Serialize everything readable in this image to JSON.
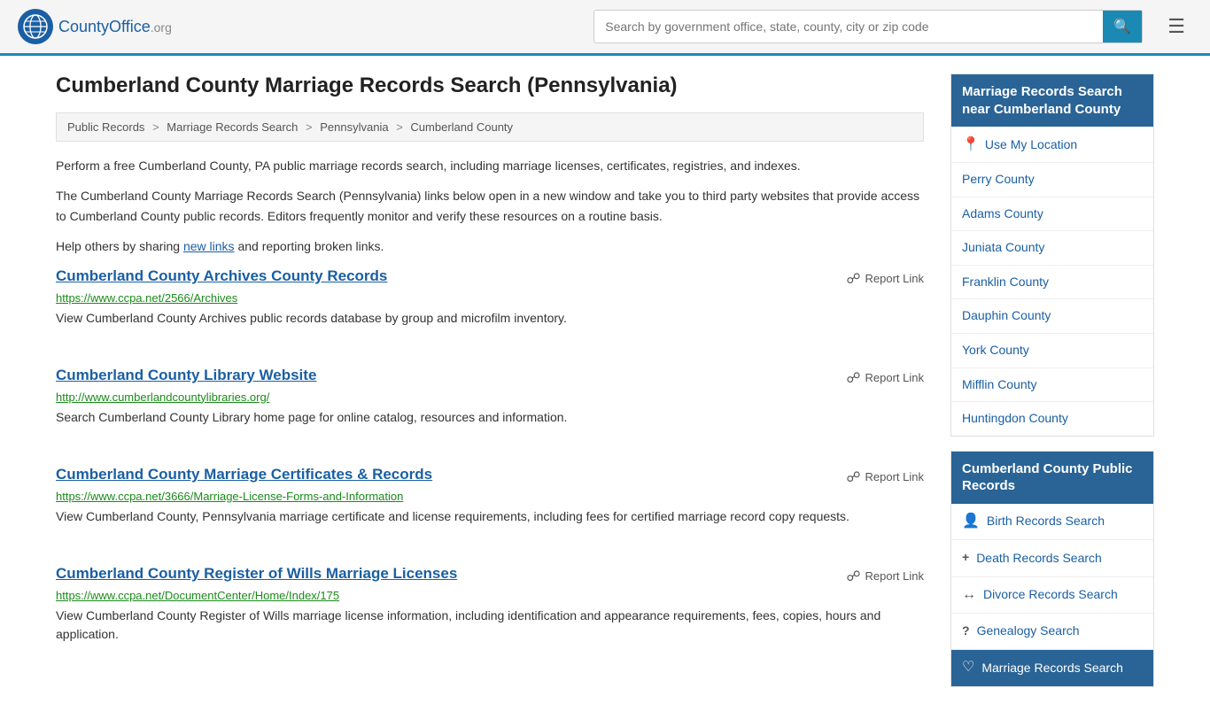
{
  "header": {
    "logo_text": "CountyOffice",
    "logo_org": ".org",
    "search_placeholder": "Search by government office, state, county, city or zip code",
    "search_value": ""
  },
  "page": {
    "title": "Cumberland County Marriage Records Search (Pennsylvania)",
    "breadcrumbs": [
      {
        "label": "Public Records",
        "href": "#"
      },
      {
        "label": "Marriage Records Search",
        "href": "#"
      },
      {
        "label": "Pennsylvania",
        "href": "#"
      },
      {
        "label": "Cumberland County",
        "href": "#"
      }
    ],
    "intro1": "Perform a free Cumberland County, PA public marriage records search, including marriage licenses, certificates, registries, and indexes.",
    "intro2": "The Cumberland County Marriage Records Search (Pennsylvania) links below open in a new window and take you to third party websites that provide access to Cumberland County public records. Editors frequently monitor and verify these resources on a routine basis.",
    "intro3_pre": "Help others by sharing ",
    "intro3_link": "new links",
    "intro3_post": " and reporting broken links."
  },
  "results": [
    {
      "title": "Cumberland County Archives County Records",
      "url": "https://www.ccpa.net/2566/Archives",
      "desc": "View Cumberland County Archives public records database by group and microfilm inventory.",
      "report_label": "Report Link"
    },
    {
      "title": "Cumberland County Library Website",
      "url": "http://www.cumberlandcountylibraries.org/",
      "desc": "Search Cumberland County Library home page for online catalog, resources and information.",
      "report_label": "Report Link"
    },
    {
      "title": "Cumberland County Marriage Certificates & Records",
      "url": "https://www.ccpa.net/3666/Marriage-License-Forms-and-Information",
      "desc": "View Cumberland County, Pennsylvania marriage certificate and license requirements, including fees for certified marriage record copy requests.",
      "report_label": "Report Link"
    },
    {
      "title": "Cumberland County Register of Wills Marriage Licenses",
      "url": "https://www.ccpa.net/DocumentCenter/Home/Index/175",
      "desc": "View Cumberland County Register of Wills marriage license information, including identification and appearance requirements, fees, copies, hours and application.",
      "report_label": "Report Link"
    }
  ],
  "sidebar": {
    "nearby_section": {
      "header": "Marriage Records Search near Cumberland County",
      "use_location_label": "Use My Location",
      "counties": [
        {
          "name": "Perry County"
        },
        {
          "name": "Adams County"
        },
        {
          "name": "Juniata County"
        },
        {
          "name": "Franklin County"
        },
        {
          "name": "Dauphin County"
        },
        {
          "name": "York County"
        },
        {
          "name": "Mifflin County"
        },
        {
          "name": "Huntingdon County"
        }
      ]
    },
    "public_records_section": {
      "header": "Cumberland County Public Records",
      "items": [
        {
          "label": "Birth Records Search",
          "icon": "👤"
        },
        {
          "label": "Death Records Search",
          "icon": "+"
        },
        {
          "label": "Divorce Records Search",
          "icon": "↔"
        },
        {
          "label": "Genealogy Search",
          "icon": "?"
        },
        {
          "label": "Marriage Records Search",
          "icon": "♡",
          "active": true
        }
      ]
    }
  }
}
